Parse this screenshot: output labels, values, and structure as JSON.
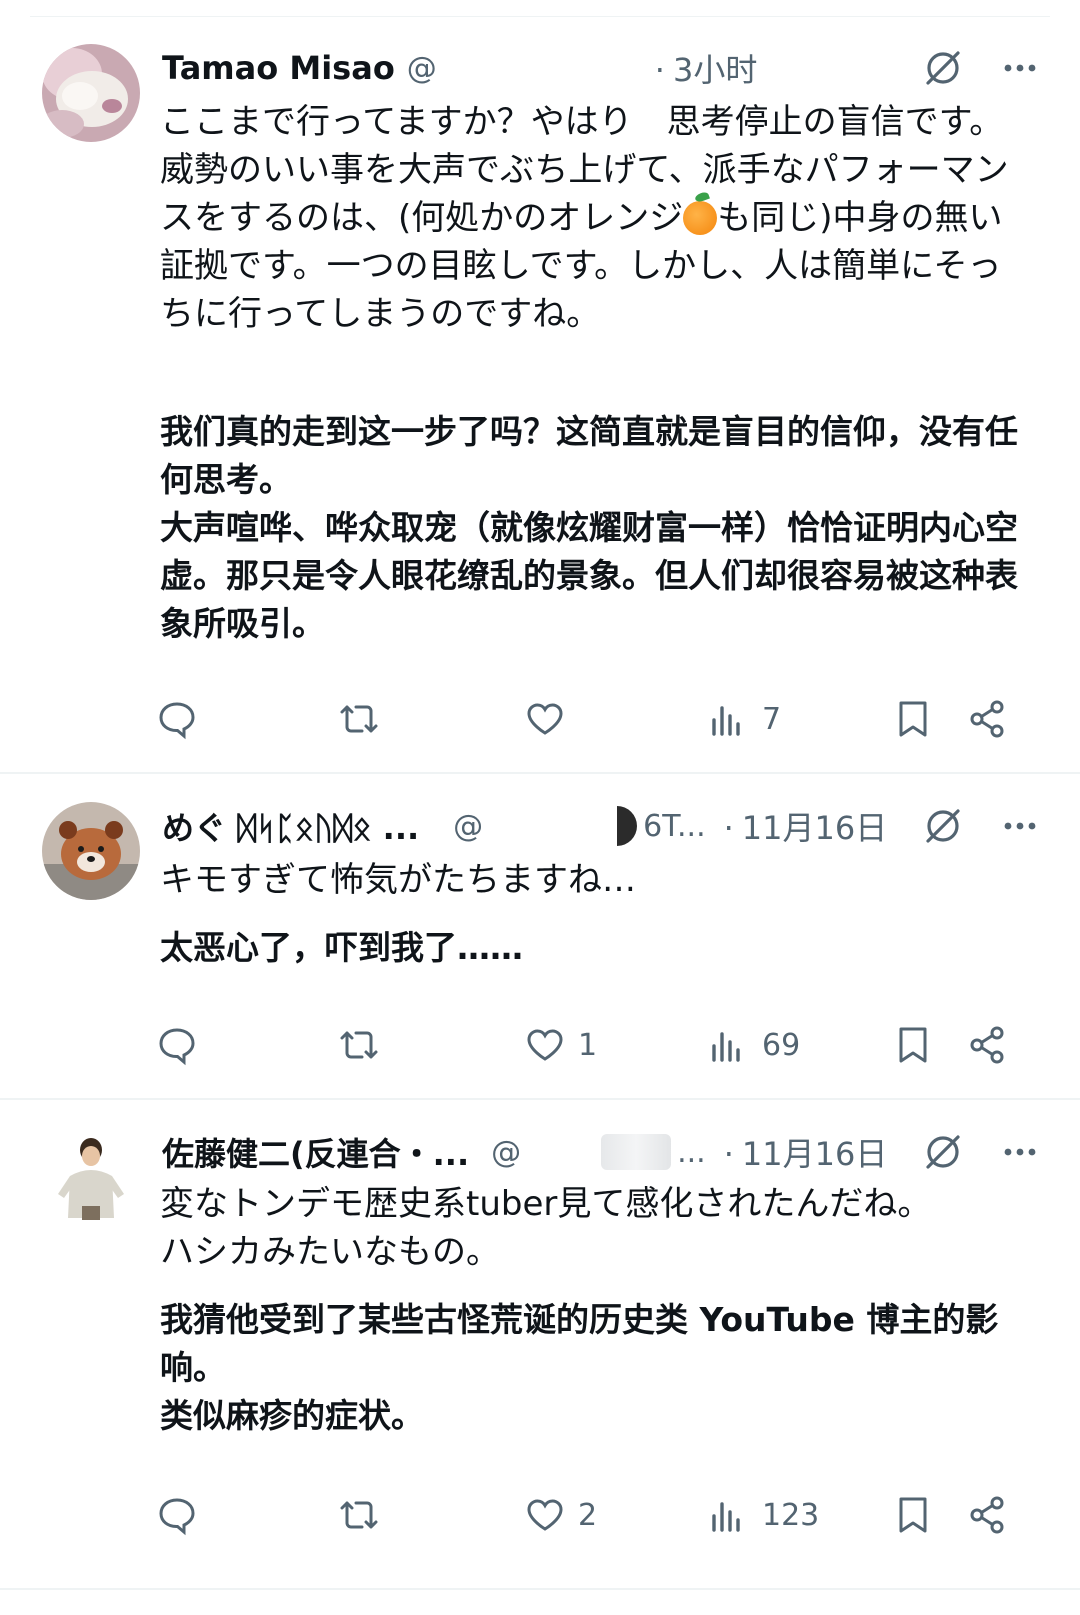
{
  "colors": {
    "text": "#0f1419",
    "muted": "#536471",
    "divider": "#eff3f4"
  },
  "tweets": [
    {
      "name": "Tamao Misao",
      "handle": "@",
      "time_sep": "·",
      "time": "3小时",
      "text_ja": "ここまで行ってますか？やはり　思考停止の盲信です。\n威勢のいい事を大声でぶち上げて、派手なパフォーマンスをするのは、(何処かのオレンジ",
      "text_ja_emoji": "orange-emoji",
      "text_ja_after": "も同じ)中身の無い証拠です。一つの目眩しです。しかし、人は簡単にそっちに行ってしまうのですね。",
      "text_zh": "我们真的走到这一步了吗？这简直就是盲目的信仰，没有任何思考。\n大声喧哗、哗众取宠（就像炫耀财富一样）恰恰证明内心空虚。那只是令人眼花缭乱的景象。但人们却很容易被这种表象所吸引。",
      "replies": "",
      "reposts": "",
      "likes": "",
      "views": "7"
    },
    {
      "name": "めぐ ᛞᛋᛈᛟᚢᛞᛟ ...",
      "handle": "@",
      "handle_tail": "6T...",
      "time_sep": "·",
      "time": "11月16日",
      "text_ja": "キモすぎて怖気がたちますね…",
      "text_zh": "太恶心了，吓到我了……",
      "replies": "",
      "reposts": "",
      "likes": "1",
      "views": "69"
    },
    {
      "name": "佐藤健二(反連合・...",
      "handle": "@",
      "handle_tail": "...",
      "time_sep": "·",
      "time": "11月16日",
      "text_ja": "変なトンデモ歴史系tuber見て感化されたんだね。\nハシカみたいなもの。",
      "text_zh": "我猜他受到了某些古怪荒诞的历史类 YouTube 博主的影响。\n类似麻疹的症状。",
      "replies": "",
      "reposts": "",
      "likes": "2",
      "views": "123"
    }
  ]
}
